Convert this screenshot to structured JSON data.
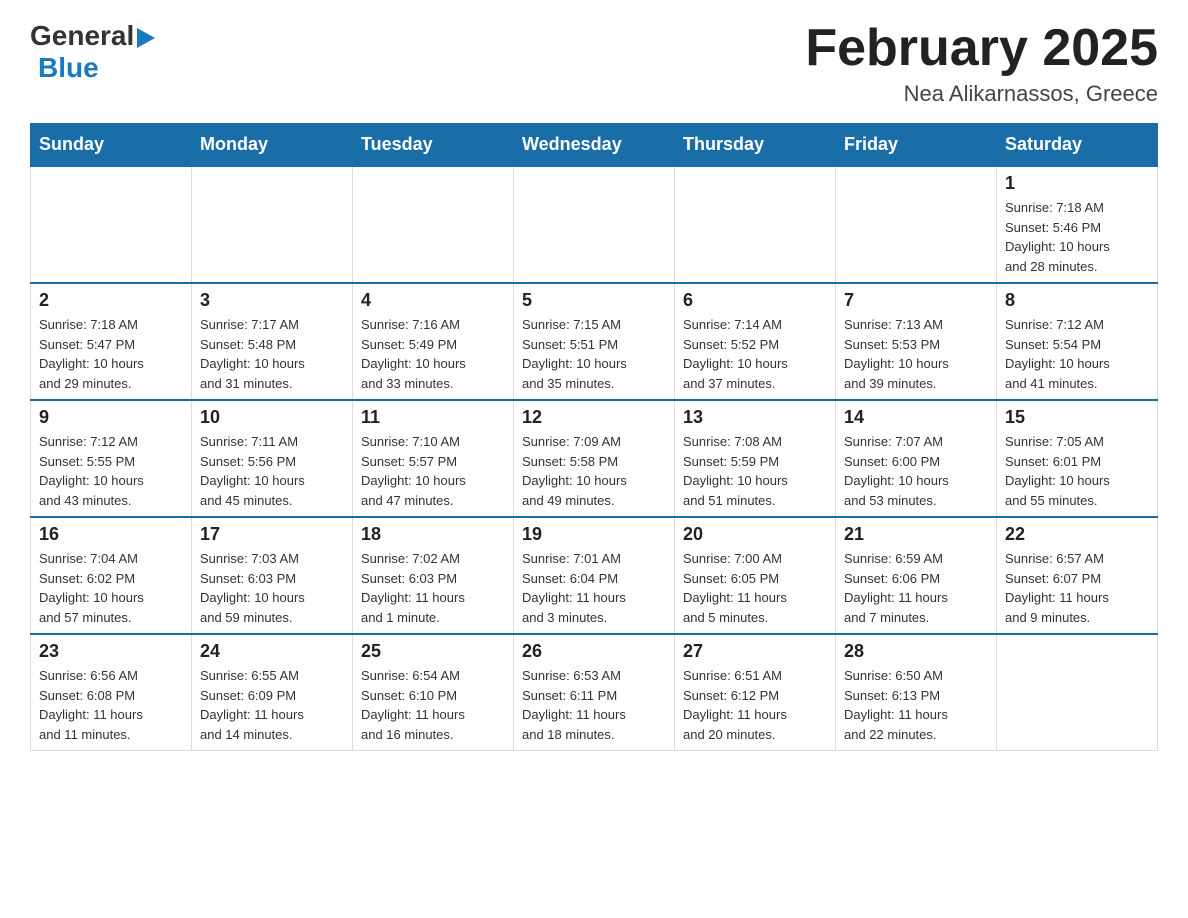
{
  "header": {
    "logo": {
      "general": "General",
      "blue": "Blue",
      "arrow": "▶"
    },
    "title": "February 2025",
    "location": "Nea Alikarnassos, Greece"
  },
  "calendar": {
    "days_of_week": [
      "Sunday",
      "Monday",
      "Tuesday",
      "Wednesday",
      "Thursday",
      "Friday",
      "Saturday"
    ],
    "weeks": [
      [
        {
          "day": "",
          "info": ""
        },
        {
          "day": "",
          "info": ""
        },
        {
          "day": "",
          "info": ""
        },
        {
          "day": "",
          "info": ""
        },
        {
          "day": "",
          "info": ""
        },
        {
          "day": "",
          "info": ""
        },
        {
          "day": "1",
          "info": "Sunrise: 7:18 AM\nSunset: 5:46 PM\nDaylight: 10 hours\nand 28 minutes."
        }
      ],
      [
        {
          "day": "2",
          "info": "Sunrise: 7:18 AM\nSunset: 5:47 PM\nDaylight: 10 hours\nand 29 minutes."
        },
        {
          "day": "3",
          "info": "Sunrise: 7:17 AM\nSunset: 5:48 PM\nDaylight: 10 hours\nand 31 minutes."
        },
        {
          "day": "4",
          "info": "Sunrise: 7:16 AM\nSunset: 5:49 PM\nDaylight: 10 hours\nand 33 minutes."
        },
        {
          "day": "5",
          "info": "Sunrise: 7:15 AM\nSunset: 5:51 PM\nDaylight: 10 hours\nand 35 minutes."
        },
        {
          "day": "6",
          "info": "Sunrise: 7:14 AM\nSunset: 5:52 PM\nDaylight: 10 hours\nand 37 minutes."
        },
        {
          "day": "7",
          "info": "Sunrise: 7:13 AM\nSunset: 5:53 PM\nDaylight: 10 hours\nand 39 minutes."
        },
        {
          "day": "8",
          "info": "Sunrise: 7:12 AM\nSunset: 5:54 PM\nDaylight: 10 hours\nand 41 minutes."
        }
      ],
      [
        {
          "day": "9",
          "info": "Sunrise: 7:12 AM\nSunset: 5:55 PM\nDaylight: 10 hours\nand 43 minutes."
        },
        {
          "day": "10",
          "info": "Sunrise: 7:11 AM\nSunset: 5:56 PM\nDaylight: 10 hours\nand 45 minutes."
        },
        {
          "day": "11",
          "info": "Sunrise: 7:10 AM\nSunset: 5:57 PM\nDaylight: 10 hours\nand 47 minutes."
        },
        {
          "day": "12",
          "info": "Sunrise: 7:09 AM\nSunset: 5:58 PM\nDaylight: 10 hours\nand 49 minutes."
        },
        {
          "day": "13",
          "info": "Sunrise: 7:08 AM\nSunset: 5:59 PM\nDaylight: 10 hours\nand 51 minutes."
        },
        {
          "day": "14",
          "info": "Sunrise: 7:07 AM\nSunset: 6:00 PM\nDaylight: 10 hours\nand 53 minutes."
        },
        {
          "day": "15",
          "info": "Sunrise: 7:05 AM\nSunset: 6:01 PM\nDaylight: 10 hours\nand 55 minutes."
        }
      ],
      [
        {
          "day": "16",
          "info": "Sunrise: 7:04 AM\nSunset: 6:02 PM\nDaylight: 10 hours\nand 57 minutes."
        },
        {
          "day": "17",
          "info": "Sunrise: 7:03 AM\nSunset: 6:03 PM\nDaylight: 10 hours\nand 59 minutes."
        },
        {
          "day": "18",
          "info": "Sunrise: 7:02 AM\nSunset: 6:03 PM\nDaylight: 11 hours\nand 1 minute."
        },
        {
          "day": "19",
          "info": "Sunrise: 7:01 AM\nSunset: 6:04 PM\nDaylight: 11 hours\nand 3 minutes."
        },
        {
          "day": "20",
          "info": "Sunrise: 7:00 AM\nSunset: 6:05 PM\nDaylight: 11 hours\nand 5 minutes."
        },
        {
          "day": "21",
          "info": "Sunrise: 6:59 AM\nSunset: 6:06 PM\nDaylight: 11 hours\nand 7 minutes."
        },
        {
          "day": "22",
          "info": "Sunrise: 6:57 AM\nSunset: 6:07 PM\nDaylight: 11 hours\nand 9 minutes."
        }
      ],
      [
        {
          "day": "23",
          "info": "Sunrise: 6:56 AM\nSunset: 6:08 PM\nDaylight: 11 hours\nand 11 minutes."
        },
        {
          "day": "24",
          "info": "Sunrise: 6:55 AM\nSunset: 6:09 PM\nDaylight: 11 hours\nand 14 minutes."
        },
        {
          "day": "25",
          "info": "Sunrise: 6:54 AM\nSunset: 6:10 PM\nDaylight: 11 hours\nand 16 minutes."
        },
        {
          "day": "26",
          "info": "Sunrise: 6:53 AM\nSunset: 6:11 PM\nDaylight: 11 hours\nand 18 minutes."
        },
        {
          "day": "27",
          "info": "Sunrise: 6:51 AM\nSunset: 6:12 PM\nDaylight: 11 hours\nand 20 minutes."
        },
        {
          "day": "28",
          "info": "Sunrise: 6:50 AM\nSunset: 6:13 PM\nDaylight: 11 hours\nand 22 minutes."
        },
        {
          "day": "",
          "info": ""
        }
      ]
    ]
  }
}
